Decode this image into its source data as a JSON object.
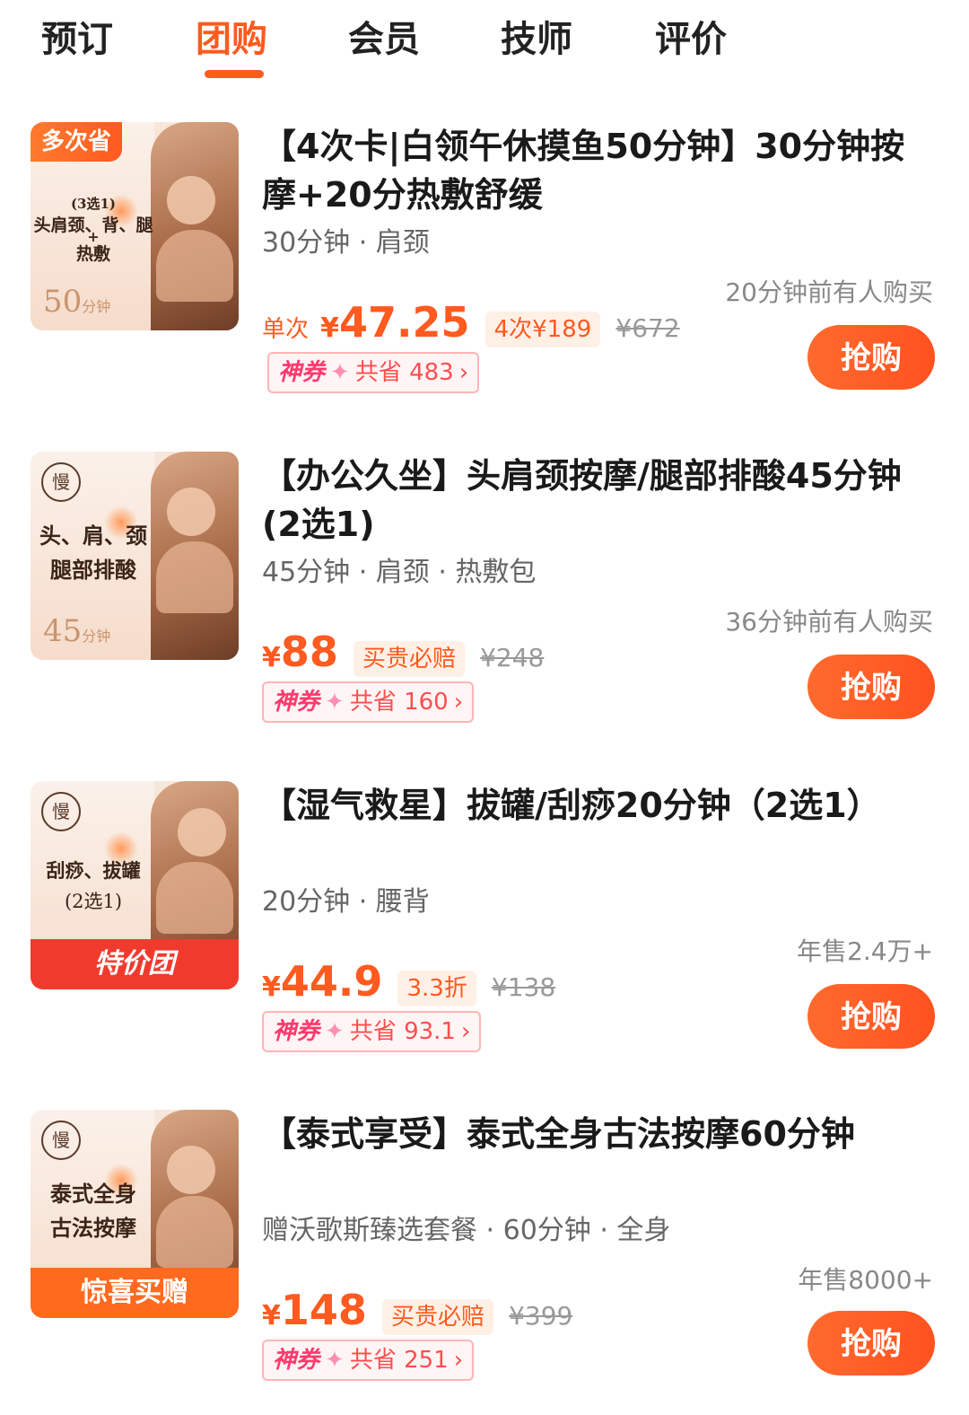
{
  "tabs": [
    "预订",
    "团购",
    "会员",
    "技师",
    "评价"
  ],
  "active_tab": "团购",
  "deals": [
    {
      "thumb": {
        "corner_badge": "多次省",
        "line1": "(3选1)",
        "line2": "头肩颈、背、腿",
        "line3": "+",
        "line4": "热敷",
        "minutes": "50",
        "minutes_unit": "分钟",
        "logo": "",
        "banner": ""
      },
      "title": "【4次卡|白领午休摸鱼50分钟】30分钟按摩+20分热敷舒缓",
      "subtitle": "30分钟 · 肩颈",
      "sold": "20分钟前有人购买",
      "price_prefix": "单次",
      "price_yen": "¥",
      "price": "47.25",
      "tag": "4次¥189",
      "original_price": "¥672",
      "coupon": {
        "label": "神券",
        "spark": "✦",
        "text": "共省 483",
        "chevron": "›"
      },
      "buy_label": "抢购"
    },
    {
      "thumb": {
        "corner_badge": "",
        "line1": "头、肩、颈",
        "line2": "腿部排酸",
        "minutes": "45",
        "minutes_unit": "分钟",
        "logo": "慢",
        "banner": ""
      },
      "title": "【办公久坐】头肩颈按摩/腿部排酸45分钟(2选1)",
      "subtitle": "45分钟 · 肩颈 · 热敷包",
      "sold": "36分钟前有人购买",
      "price_prefix": "",
      "price_yen": "¥",
      "price": "88",
      "tag": "买贵必赔",
      "original_price": "¥248",
      "coupon": {
        "label": "神券",
        "spark": "✦",
        "text": "共省 160",
        "chevron": "›"
      },
      "buy_label": "抢购"
    },
    {
      "thumb": {
        "corner_badge": "",
        "line1": "刮痧、拔罐",
        "line2": "(2选1)",
        "minutes": "",
        "minutes_unit": "",
        "logo": "慢",
        "banner": "特价团",
        "banner_color": "#f03a2e"
      },
      "title": "【湿气救星】拔罐/刮痧20分钟（2选1）",
      "subtitle": "20分钟 · 腰背",
      "sold": "年售2.4万+",
      "price_prefix": "",
      "price_yen": "¥",
      "price": "44.9",
      "tag": "3.3折",
      "original_price": "¥138",
      "coupon": {
        "label": "神券",
        "spark": "✦",
        "text": "共省 93.1",
        "chevron": "›"
      },
      "buy_label": "抢购"
    },
    {
      "thumb": {
        "corner_badge": "",
        "line1": "泰式全身",
        "line2": "古法按摩",
        "minutes": "",
        "minutes_unit": "",
        "logo": "慢",
        "banner": "惊喜买赠",
        "banner_color": "#ff6a1f"
      },
      "title": "【泰式享受】泰式全身古法按摩60分钟",
      "subtitle": "赠沃歌斯臻选套餐 · 60分钟 · 全身",
      "sold": "年售8000+",
      "price_prefix": "",
      "price_yen": "¥",
      "price": "148",
      "tag": "买贵必赔",
      "original_price": "¥399",
      "coupon": {
        "label": "神券",
        "spark": "✦",
        "text": "共省 251",
        "chevron": "›"
      },
      "buy_label": "抢购"
    }
  ]
}
